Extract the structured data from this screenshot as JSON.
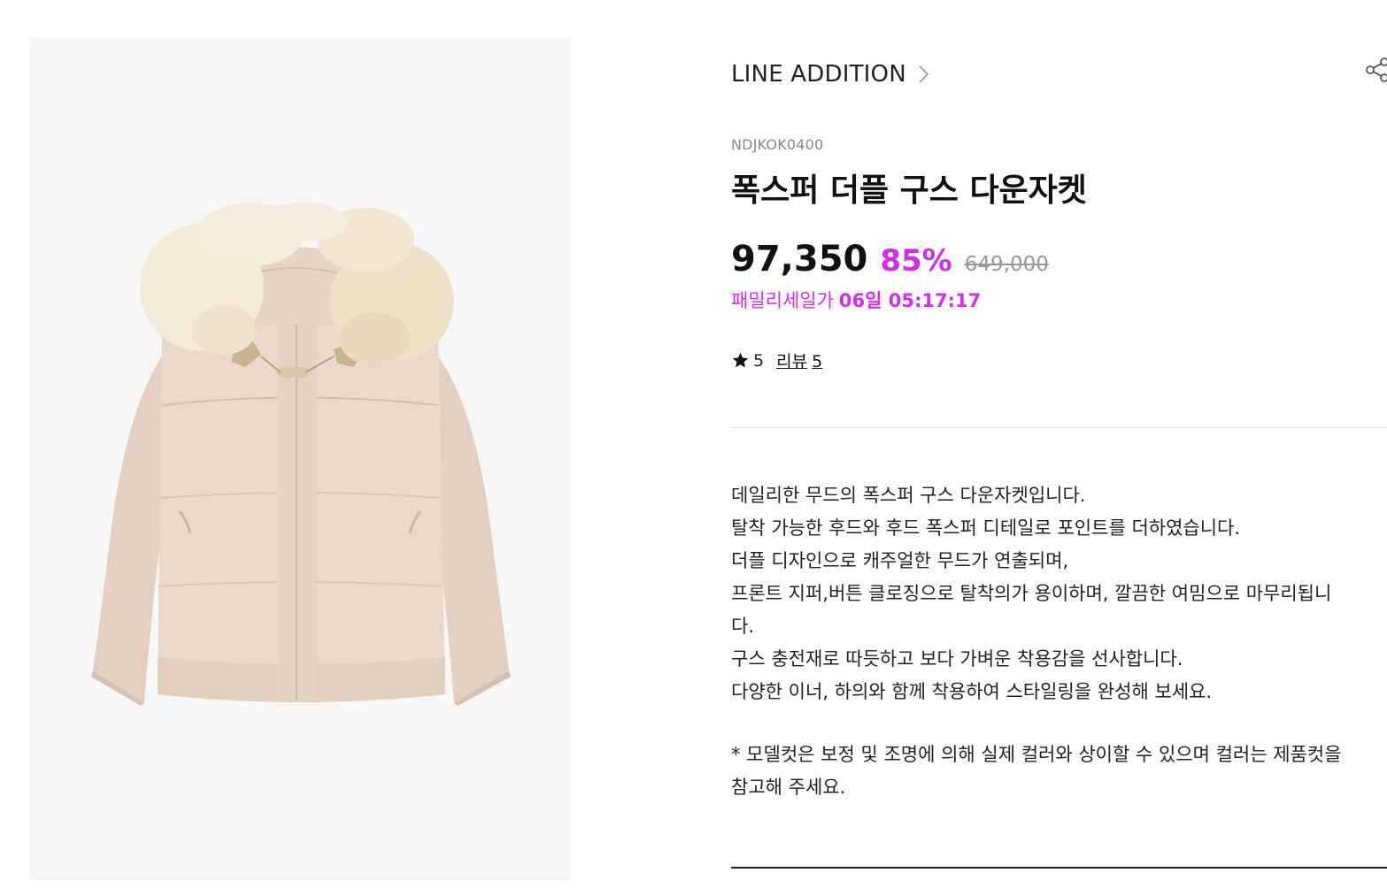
{
  "product": {
    "brand": "LINE ADDITION",
    "code": "NDJKOK0400",
    "title": "폭스퍼 더플 구스 다운자켓",
    "image_alt": "폭스퍼 더플 구스 다운자켓"
  },
  "pricing": {
    "sale_price": "97,350",
    "discount": "85%",
    "original_price": "649,000",
    "sale_label": "패밀리세일가",
    "countdown": "06일 05:17:17"
  },
  "rating": {
    "score": "5",
    "review_label": "리뷰",
    "review_count": "5"
  },
  "description": {
    "lines": [
      "데일리한 무드의 폭스퍼 구스 다운자켓입니다.",
      "탈착 가능한 후드와 후드 폭스퍼 디테일로 포인트를 더하였습니다.",
      "더플 디자인으로 캐주얼한 무드가 연출되며,",
      "프론트 지퍼,버튼 클로징으로 탈착의가 용이하며, 깔끔한 여밈으로 마무리됩니",
      "다.",
      "구스 충전재로 따듯하고 보다 가벼운 착용감을 선사합니다.",
      "다양한 이너, 하의와 함께 착용하여 스타일링을 완성해 보세요."
    ],
    "notice_lines": [
      "* 모델컷은 보정 및 조명에 의해 실제 컬러와 상이할 수 있으며 컬러는 제품컷을",
      "참고해 주세요."
    ]
  },
  "icons": {
    "brand_chevron": "chevron-right-icon",
    "share": "share-icon",
    "star": "star-icon"
  },
  "colors": {
    "accent": "#d22ee8",
    "image_background": "#f7f7f7",
    "jacket_body": "#e8d6c8",
    "fur": "#f3ead8"
  }
}
